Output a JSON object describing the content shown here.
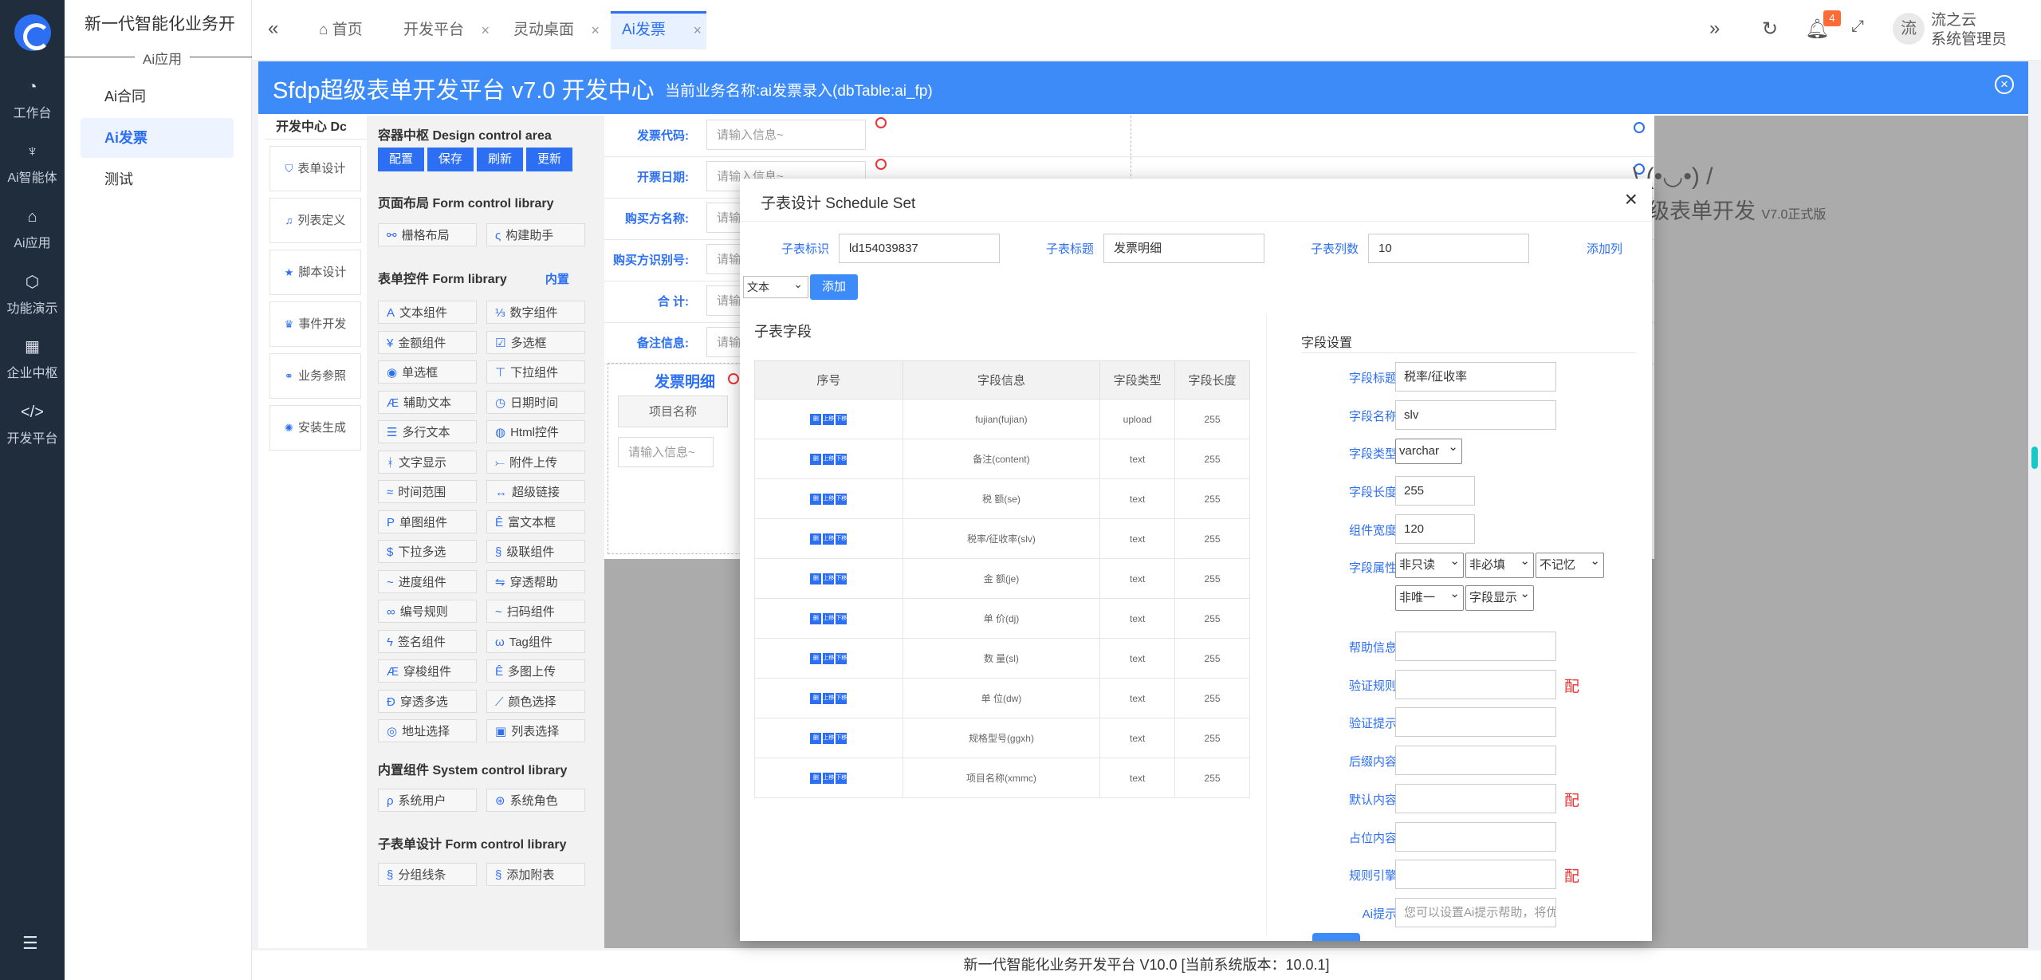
{
  "rail": {
    "items": [
      {
        "icon": "dashboard-icon",
        "glyph": "◔",
        "label": "工作台"
      },
      {
        "icon": "ai-agent-icon",
        "glyph": "♆",
        "label": "Ai智能体"
      },
      {
        "icon": "ai-app-icon",
        "glyph": "⌂",
        "label": "Ai应用"
      },
      {
        "icon": "cube-icon",
        "glyph": "⬡",
        "label": "功能演示"
      },
      {
        "icon": "grid-icon",
        "glyph": "▦",
        "label": "企业中枢"
      },
      {
        "icon": "code-icon",
        "glyph": "</>",
        "label": "开发平台"
      }
    ]
  },
  "subnav": {
    "app_title": "新一代智能化业务开",
    "group_label": "Ai应用",
    "items": [
      "Ai合同",
      "Ai发票",
      "测试"
    ]
  },
  "topbar": {
    "tabs": [
      "首页",
      "开发平台",
      "灵动桌面",
      "Ai发票"
    ],
    "notification_count": "4",
    "avatar_text": "流",
    "user_line1": "流之云",
    "user_line2": "系统管理员"
  },
  "banner": {
    "title": "Sfdp超级表单开发平台 v7.0 开发中心",
    "subtitle": "当前业务名称:ai发票录入(dbTable:ai_fp)"
  },
  "devcenter": {
    "header": "开发中心 Dc",
    "buttons": [
      "表单设计",
      "列表定义",
      "脚本设计",
      "事件开发",
      "业务参照",
      "安装生成"
    ]
  },
  "library": {
    "container_header": "容器中枢 Design control area",
    "container_buttons": [
      "配置",
      "保存",
      "刷新",
      "更新"
    ],
    "layout_header": "页面布局 Form control library",
    "layout_buttons": [
      "栅格布局",
      "构建助手"
    ],
    "form_header": "表单控件 Form library",
    "form_link": "内置",
    "form_buttons": [
      "文本组件",
      "数字组件",
      "金额组件",
      "多选框",
      "单选框",
      "下拉组件",
      "辅助文本",
      "日期时间",
      "多行文本",
      "Html控件",
      "文字显示",
      "附件上传",
      "时间范围",
      "超级链接",
      "单图组件",
      "富文本框",
      "下拉多选",
      "级联组件",
      "进度组件",
      "穿透帮助",
      "编号规则",
      "扫码组件",
      "签名组件",
      "Tag组件",
      "穿梭组件",
      "多图上传",
      "穿透多选",
      "颜色选择",
      "地址选择",
      "列表选择"
    ],
    "system_header": "内置组件 System control library",
    "system_buttons": [
      "系统用户",
      "系统角色"
    ],
    "subform_header": "子表单设计 Form control library",
    "subform_buttons": [
      "分组线条",
      "添加附表"
    ]
  },
  "form": {
    "rows": [
      {
        "label": "发票代码:",
        "placeholder": "请输入信息~"
      },
      {
        "label": "开票日期:",
        "placeholder": "请输入信息~"
      },
      {
        "label": "购买方名称:",
        "placeholder": "请输"
      },
      {
        "label": "购买方识别号:",
        "placeholder": "请输"
      },
      {
        "label": "合 计:",
        "placeholder": "请输"
      },
      {
        "label": "备注信息:",
        "placeholder": "请输"
      }
    ],
    "subtable_title": "发票明细",
    "subtable_col": "项目名称",
    "subtable_placeholder": "请输入信息~"
  },
  "brand": {
    "face": "\\ (•◡•) /",
    "name": "超级表单开发",
    "version": "V7.0正式版"
  },
  "modal": {
    "title": "子表设计 Schedule Set",
    "id_label": "子表标识",
    "id_value": "ld154039837",
    "title_label": "子表标题",
    "title_value": "发票明细",
    "cols_label": "子表列数",
    "cols_value": "10",
    "add_col_link": "添加列",
    "type_select": "文本",
    "add_button": "添加",
    "fields_header": "子表字段",
    "table_headers": [
      "序号",
      "字段信息",
      "字段类型",
      "字段长度"
    ],
    "row_actions": [
      "删",
      "上移",
      "下移"
    ],
    "rows": [
      {
        "info": "fujian(fujian)",
        "type": "upload",
        "len": "255"
      },
      {
        "info": "备注(content)",
        "type": "text",
        "len": "255"
      },
      {
        "info": "税 额(se)",
        "type": "text",
        "len": "255"
      },
      {
        "info": "税率/征收率(slv)",
        "type": "text",
        "len": "255"
      },
      {
        "info": "金 额(je)",
        "type": "text",
        "len": "255"
      },
      {
        "info": "单 价(dj)",
        "type": "text",
        "len": "255"
      },
      {
        "info": "数 量(sl)",
        "type": "text",
        "len": "255"
      },
      {
        "info": "单 位(dw)",
        "type": "text",
        "len": "255"
      },
      {
        "info": "规格型号(ggxh)",
        "type": "text",
        "len": "255"
      },
      {
        "info": "项目名称(xmmc)",
        "type": "text",
        "len": "255"
      }
    ],
    "settings_header": "字段设置",
    "settings": {
      "field_title_label": "字段标题",
      "field_title": "税率/征收率",
      "field_name_label": "字段名称",
      "field_name": "slv",
      "field_type_label": "字段类型",
      "field_type": "varchar",
      "field_len_label": "字段长度",
      "field_len": "255",
      "comp_width_label": "组件宽度",
      "comp_width": "120",
      "attr_label": "字段属性",
      "attr_readonly": "非只读",
      "attr_required": "非必填",
      "attr_remember": "不记忆",
      "attr_unique": "非唯一",
      "attr_display": "字段显示",
      "help_label": "帮助信息",
      "rule_label": "验证规则",
      "tip_label": "验证提示",
      "suffix_label": "后缀内容",
      "default_label": "默认内容",
      "placeholder_label": "占位内容",
      "engine_label": "规则引擎",
      "ai_label": "Ai提示",
      "ai_placeholder": "您可以设置Ai提示帮助，将优",
      "pei": "配"
    }
  },
  "footer": "新一代智能化业务开发平台 V10.0 [当前系统版本：10.0.1]",
  "colors": {
    "accent": "#2d6ff2",
    "banner": "#3d8bf8",
    "rail": "#1f2d3d",
    "danger": "#ee3333"
  }
}
